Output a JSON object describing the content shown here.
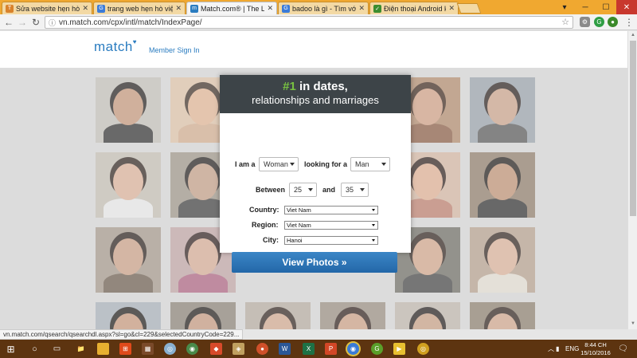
{
  "browser": {
    "tabs": [
      {
        "title": "Sửa website hẹn hò nổi tiếng",
        "favicon": "T",
        "color": "#d9822b"
      },
      {
        "title": "trang web hẹn hò việt nam",
        "favicon": "G",
        "color": "#3b7bd8"
      },
      {
        "title": "Match.com® | The Leading",
        "favicon": "m",
        "color": "#2a7cc0"
      },
      {
        "title": "badoo là gì - Tìm với Google",
        "favicon": "G",
        "color": "#3b7bd8"
      },
      {
        "title": "Điện thoại Android không",
        "favicon": "✓",
        "color": "#3c8d2f"
      }
    ],
    "url": "vn.match.com/cpx/intl/match/IndexPage/",
    "status_url": "vn.match.com/qsearch/qsearchdl.aspx?sl=go&cl=229&selectedCountryCode=229..."
  },
  "site": {
    "logo": "match",
    "member_sign_in": "Member Sign In"
  },
  "modal": {
    "headline_num": "#1",
    "headline_rest": " in dates,",
    "subheadline": "relationships and marriages",
    "i_am_label": "I am a",
    "i_am_value": "Woman",
    "looking_label": "looking for a",
    "looking_value": "Man",
    "between_label": "Between",
    "age_from": "25",
    "and_label": "and",
    "age_to": "35",
    "country_label": "Country:",
    "country_value": "Viet Nam",
    "region_label": "Region:",
    "region_value": "Viet Nam",
    "city_label": "City:",
    "city_value": "Hanoi",
    "button_label": "View Photos »"
  },
  "taskbar": {
    "lang": "ENG",
    "time": "8:44 CH",
    "date": "15/10/2016"
  },
  "photos": [
    {
      "bg": "#c7c3bc",
      "skin": "#c9997a",
      "hair": "#1e1a18",
      "shirt": "#2b2b2b"
    },
    {
      "bg": "#e3c7aa",
      "skin": "#e9b896",
      "hair": "#3a2a20",
      "shirt": "#d8b090"
    },
    {
      "bg": "#b48a6a",
      "skin": "#d6a184",
      "hair": "#3a2216",
      "shirt": "#8a5a40"
    },
    {
      "bg": "#9aa3ad",
      "skin": "#d0a58a",
      "hair": "#241a16",
      "shirt": "#555555"
    },
    {
      "bg": "#c8c2b6",
      "skin": "#e2b49a",
      "hair": "#2a1e18",
      "shirt": "#eeeeee"
    },
    {
      "bg": "#9e9688",
      "skin": "#c8a086",
      "hair": "#1c1816",
      "shirt": "#3a3a3a"
    },
    {
      "bg": "#d9b8a4",
      "skin": "#e6b394",
      "hair": "#2a1a14",
      "shirt": "#c07d6a"
    },
    {
      "bg": "#8f7c68",
      "skin": "#c49372",
      "hair": "#1a1412",
      "shirt": "#2a2a2a"
    },
    {
      "bg": "#a7998a",
      "skin": "#cfa286",
      "hair": "#241a14",
      "shirt": "#6a5a4a"
    },
    {
      "bg": "#c4a6a6",
      "skin": "#dcae96",
      "hair": "#2a1a18",
      "shirt": "#b06080"
    },
    {
      "bg": "#6c6a62",
      "skin": "#d8a88a",
      "hair": "#2a1c16",
      "shirt": "#404040"
    },
    {
      "bg": "#b8a28e",
      "skin": "#e0b49a",
      "hair": "#2c1e18",
      "shirt": "#e8e2d6"
    },
    {
      "bg": "#a9b2bc",
      "skin": "#cc9a7c",
      "hair": "#181412",
      "shirt": "#202020"
    },
    {
      "bg": "#8a8276",
      "skin": "#c99a7e",
      "hair": "#1a1412",
      "shirt": "#f0f0f0"
    },
    {
      "bg": "#9c9a94",
      "skin": "#c89c7e",
      "hair": "#1c1614",
      "shirt": "#3a4a6a"
    },
    {
      "bg": "#bdbab2",
      "skin": "#cf9d80",
      "hair": "#181412",
      "shirt": "#3c72c2"
    },
    {
      "bg": "#c2b8ae",
      "skin": "#cda184",
      "hair": "#1c1614",
      "shirt": "#2c2c2c"
    },
    {
      "bg": "#8d7e6c",
      "skin": "#d6a88c",
      "hair": "#2a1c16",
      "shirt": "#5a4a3a"
    },
    {
      "bg": "#b9aea2",
      "skin": "#d8ab90",
      "hair": "#2c1e18",
      "shirt": "#e0d8cc"
    },
    {
      "bg": "#9a8e80",
      "skin": "#d2a284",
      "hair": "#2a1a14",
      "shirt": "#7a6a5a"
    },
    {
      "bg": "#7c7a74",
      "skin": "#cc9c80",
      "hair": "#1c1614",
      "shirt": "#3a3a3a"
    },
    {
      "bg": "#c9c4bc",
      "skin": "#e0b498",
      "hair": "#2a1a14",
      "shirt": "#c24040"
    },
    {
      "bg": "#e2cc9a",
      "skin": "#e2cc9a",
      "hair": "#e2cc9a",
      "shirt": "#e2cc9a"
    }
  ]
}
